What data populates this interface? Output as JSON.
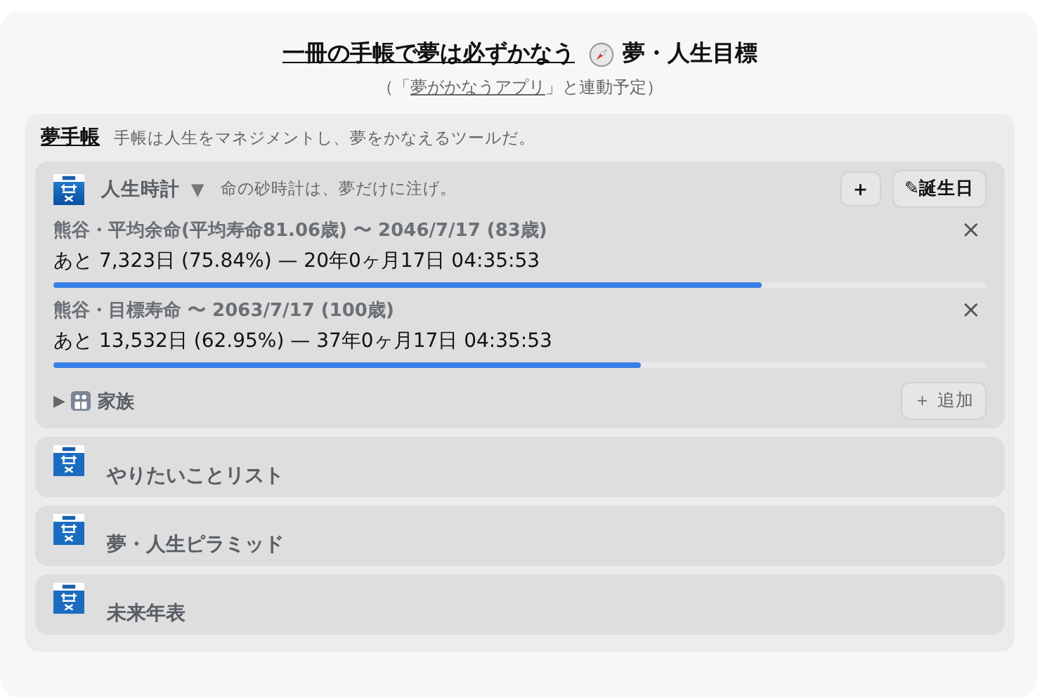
{
  "header": {
    "title": "一冊の手帳で夢は必ずかなう",
    "subtitle": "夢・人生目標",
    "note_before": "（「",
    "note_link": "夢がかなうアプリ",
    "note_after": "」と連動予定）"
  },
  "notebook": {
    "title": "夢手帳",
    "description": "手帳は人生をマネジメントし、夢をかなえるツールだ。"
  },
  "life_clock": {
    "title": "人生時計",
    "toggle": "▼",
    "description": "命の砂時計は、夢だけに注げ。",
    "add_button": "+",
    "birthday_button": "✎誕生日",
    "timers": [
      {
        "label": "熊谷・平均余命(平均寿命81.06歳) 〜 2046/7/17 (83歳)",
        "remaining": "あと 7,323日 (75.84%) — 20年0ヶ月17日 04:35:53",
        "level": 0.7584,
        "close": "×"
      },
      {
        "label": "熊谷・目標寿命 〜 2063/7/17 (100歳)",
        "remaining": "あと 13,532日 (62.95%) — 37年0ヶ月17日 04:35:53",
        "level": 0.6295,
        "close": "×"
      }
    ],
    "family": {
      "toggle": "▶",
      "label": "家族",
      "expanded": false,
      "add_button": "＋ 追加"
    }
  },
  "sections": [
    {
      "title": "やりたいことリスト"
    },
    {
      "title": "夢・人生ピラミッド"
    },
    {
      "title": "未来年表"
    }
  ]
}
